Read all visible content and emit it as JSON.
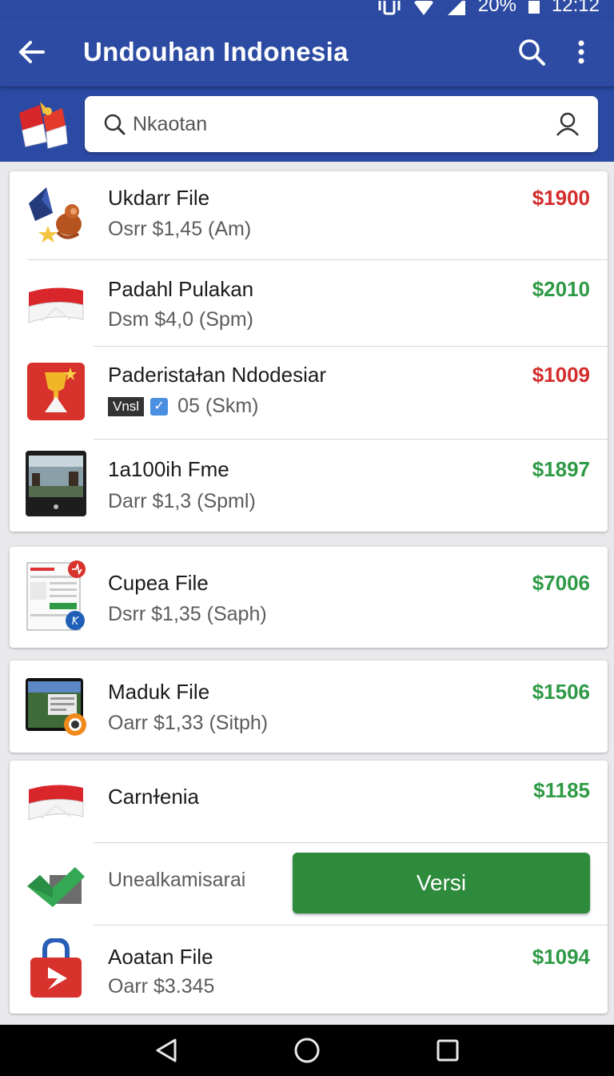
{
  "status_bar": {
    "battery": "20%",
    "time": "12:12"
  },
  "app_bar": {
    "title": "Undouhan Indonesia",
    "back_icon": "arrow-back-icon",
    "search_icon": "search-icon",
    "more_icon": "more-vert-icon"
  },
  "search": {
    "placeholder": "Nkaotan",
    "left_icon": "search-icon",
    "right_icon": "user-icon"
  },
  "cards": [
    {
      "items": [
        {
          "title": "Ukdarr File",
          "subtitle": "Osrr $1,45 (Am)",
          "price": "$1900",
          "price_color": "#d42c2c",
          "icon": "kite-monkey-icon"
        },
        {
          "title": "Padahl Pulakan",
          "subtitle": "Dsm $4,0 (Spm)",
          "price": "$2010",
          "price_color": "#2e9a45",
          "icon": "indonesia-flag-icon"
        },
        {
          "title": "Paderistaɫan Ndodesiar",
          "badge": "Vnsl",
          "subtitle": "05 (Skm)",
          "price": "$1009",
          "price_color": "#d42c2c",
          "icon": "trophy-icon"
        },
        {
          "title": "1a100ih Fme",
          "subtitle": "Darr $1,3 (Spml)",
          "price": "$1897",
          "price_color": "#2e9a45",
          "icon": "video-thumbnail-icon"
        }
      ]
    },
    {
      "items": [
        {
          "title": "Cupea File",
          "subtitle": "Dsrr $1,35 (Saph)",
          "price": "$7006",
          "price_color": "#2e9a45",
          "icon": "document-thumbnail-icon"
        }
      ]
    },
    {
      "items": [
        {
          "title": "Maduk File",
          "subtitle": "Oarr $1,33 (Sitph)",
          "price": "$1506",
          "price_color": "#2e9a45",
          "icon": "tablet-thumbnail-icon"
        }
      ]
    },
    {
      "items": [
        {
          "title": "Carnɫenia",
          "price": "$1185",
          "price_color": "#2e9a45",
          "icon": "indonesia-flag-icon"
        },
        {
          "title": "Unealkamisarai",
          "button": "Versi",
          "icon": "check-icon"
        },
        {
          "title": "Aoatan File",
          "subtitle": "Oarr $3.345",
          "price": "$1094",
          "price_color": "#2e9a45",
          "icon": "lock-play-icon"
        }
      ]
    }
  ],
  "nav_bar": {
    "back": "nav-back-icon",
    "home": "nav-home-icon",
    "recents": "nav-recents-icon"
  }
}
